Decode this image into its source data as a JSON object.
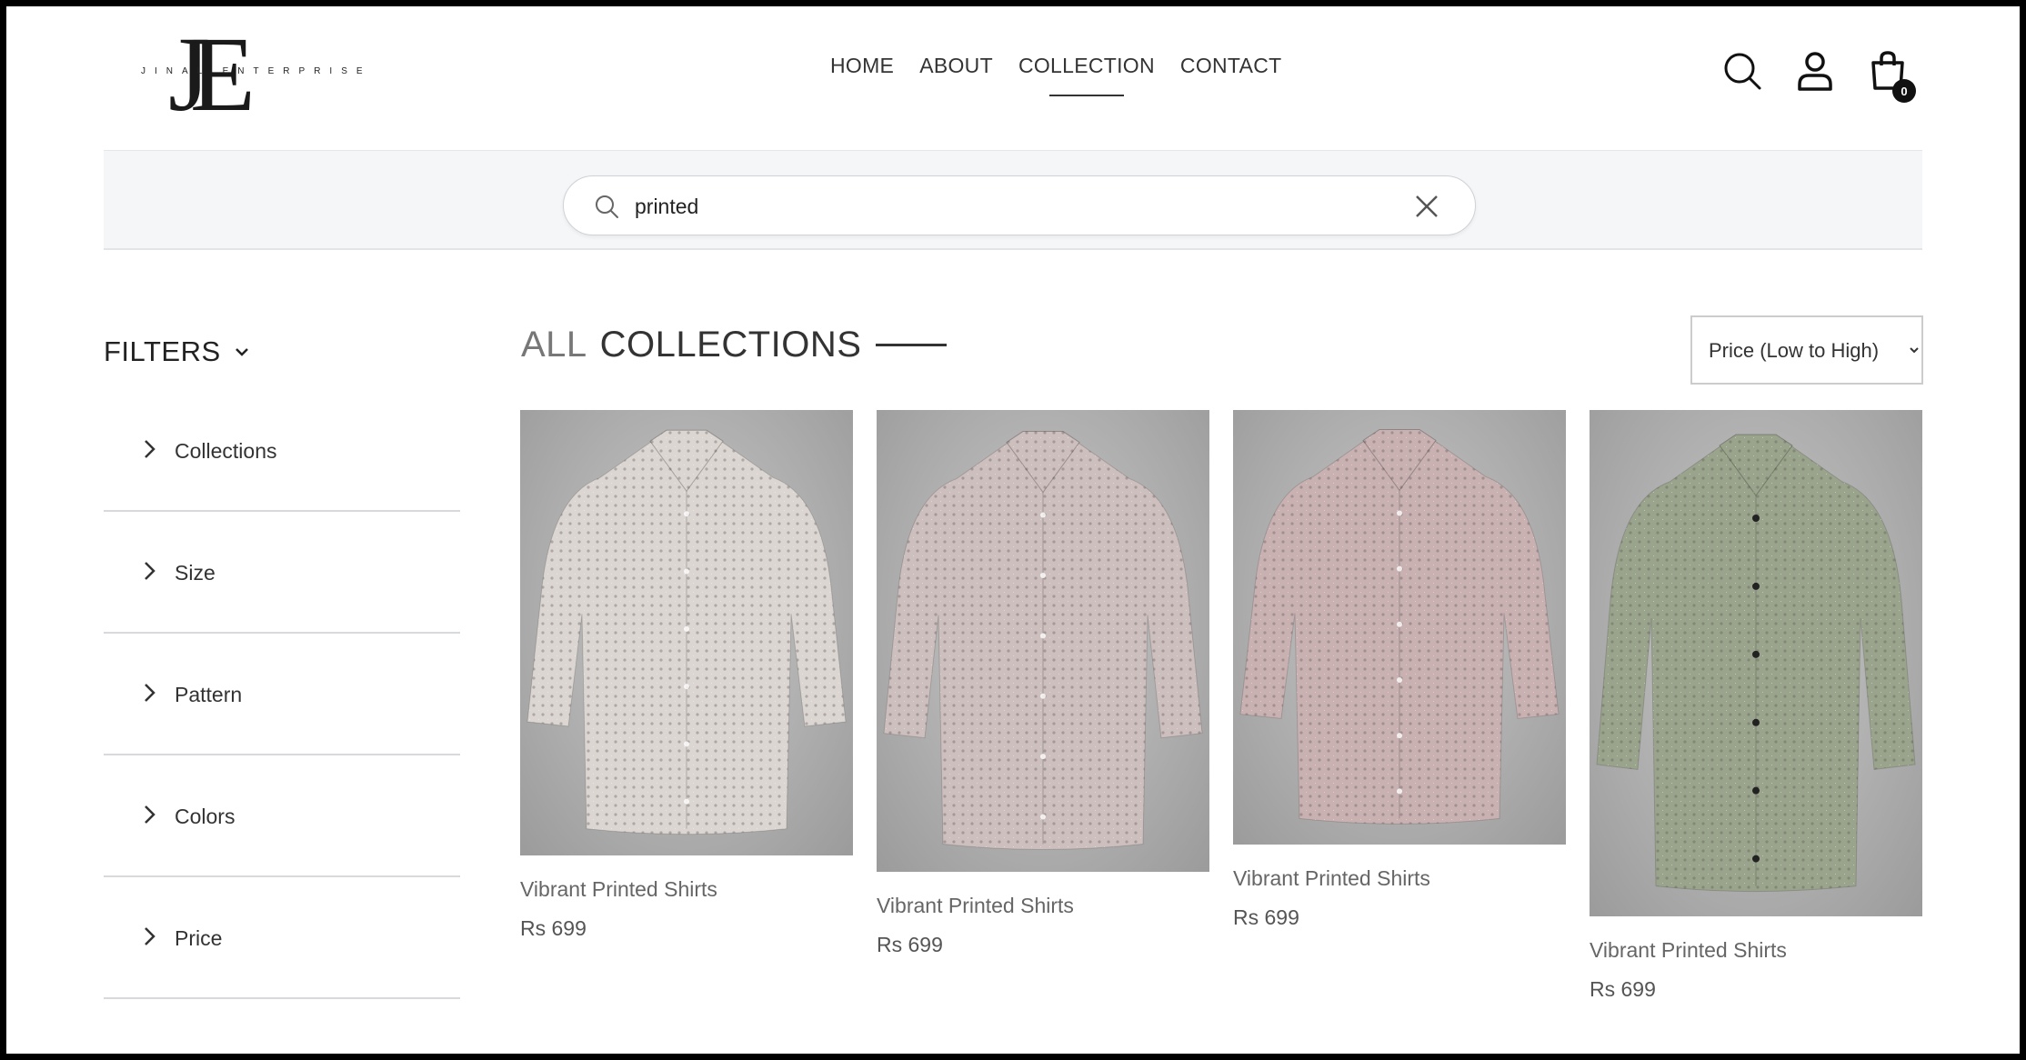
{
  "brand": {
    "monogram": "JE",
    "name": "JINAL ENTERPRISE"
  },
  "nav": [
    {
      "label": "HOME",
      "active": false
    },
    {
      "label": "ABOUT",
      "active": false
    },
    {
      "label": "COLLECTION",
      "active": true
    },
    {
      "label": "CONTACT",
      "active": false
    }
  ],
  "header_icons": [
    "search-icon",
    "user-icon",
    "shopping-bag-icon"
  ],
  "cart": {
    "count": "0"
  },
  "search": {
    "value": "printed"
  },
  "filters": {
    "title": "FILTERS",
    "items": [
      {
        "label": "Collections"
      },
      {
        "label": "Size"
      },
      {
        "label": "Pattern"
      },
      {
        "label": "Colors"
      },
      {
        "label": "Price"
      }
    ]
  },
  "collection": {
    "title_light": "ALL",
    "title_dark": "COLLECTIONS"
  },
  "sort": {
    "selected": "Price (Low to High)"
  },
  "products": [
    {
      "name": "Vibrant Printed Shirts",
      "price": "Rs 699",
      "color": "#dcd6d2"
    },
    {
      "name": "Vibrant Printed Shirts",
      "price": "Rs 699",
      "color": "#cdbfbe"
    },
    {
      "name": "Vibrant Printed Shirts",
      "price": "Rs 699",
      "color": "#c9b1b2"
    },
    {
      "name": "Vibrant Printed Shirts",
      "price": "Rs 699",
      "color": "#9aa48c"
    }
  ],
  "colors": {
    "text_dark": "#333333",
    "background": "#ffffff",
    "strip": "#f5f6f8"
  }
}
